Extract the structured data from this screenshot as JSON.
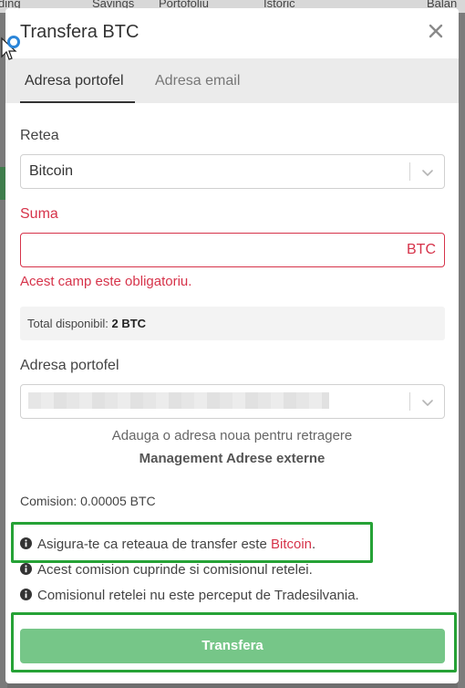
{
  "background": {
    "strip_items": [
      "ding",
      "Savings",
      "Portofoliu",
      "Istoric",
      "Balan"
    ]
  },
  "modal": {
    "title": "Transfera BTC",
    "close_icon": "close-icon",
    "tabs": [
      {
        "label": "Adresa portofel",
        "active": true
      },
      {
        "label": "Adresa email",
        "active": false
      }
    ],
    "network": {
      "label": "Retea",
      "value": "Bitcoin"
    },
    "amount": {
      "label": "Suma",
      "value": "",
      "suffix": "BTC",
      "error": "Acest camp este obligatoriu."
    },
    "total": {
      "label": "Total disponibil:",
      "value": "2 BTC"
    },
    "wallet": {
      "label": "Adresa portofel"
    },
    "add_address_hint": "Adauga o adresa noua pentru retragere",
    "manage_link": "Management Adrese externe",
    "commission": "Comision: 0.00005 BTC",
    "notes": [
      {
        "prefix": "Asigura-te ca reteaua de transfer este ",
        "network": "Bitcoin",
        "suffix": "."
      },
      {
        "text": "Acest comision cuprinde si comisionul retelei."
      },
      {
        "text": "Comisionul retelei nu este perceput de Tradesilvania."
      }
    ],
    "submit_label": "Transfera"
  },
  "colors": {
    "error": "#d6334a",
    "submit": "#76c688",
    "highlight": "#26a236"
  }
}
